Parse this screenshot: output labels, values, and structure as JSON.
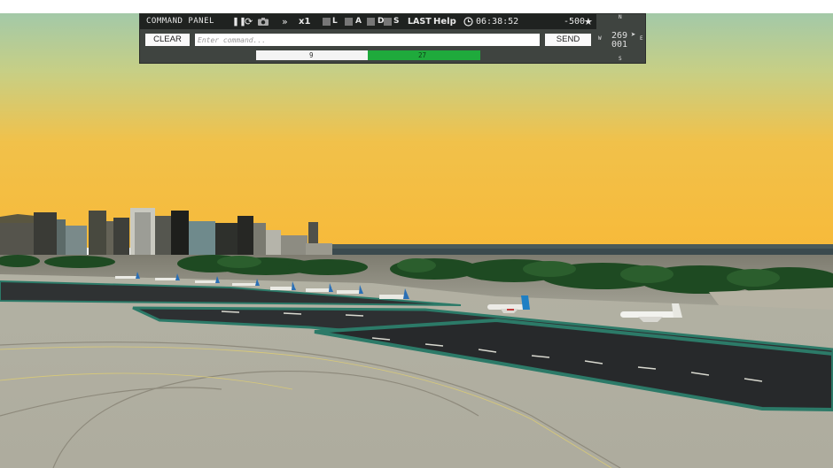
{
  "panel": {
    "title": "COMMAND PANEL",
    "icons": [
      "pause-icon",
      "refresh-icon",
      "camera-icon",
      "fast-forward-icon"
    ],
    "speed": "x1",
    "toggles": [
      {
        "label": "L",
        "active": false
      },
      {
        "label": "A",
        "active": false
      },
      {
        "label": "D",
        "active": false
      },
      {
        "label": "S",
        "active": false
      }
    ],
    "last_label": "LAST",
    "help_label": "Help",
    "clock": "06:38:52",
    "score": "-500",
    "clear_label": "CLEAR",
    "command_placeholder": "Enter command...",
    "send_label": "SEND"
  },
  "progress": {
    "left_value": "9",
    "right_value": "27",
    "left_fraction": 0.5
  },
  "compass": {
    "north": "N",
    "south": "S",
    "west": "W",
    "east": "E",
    "heading": "269",
    "altitude": "001"
  },
  "colors": {
    "panel_bg": "#3f4440",
    "panel_bar": "#1f2220",
    "progress_green": "#1faa3c"
  }
}
